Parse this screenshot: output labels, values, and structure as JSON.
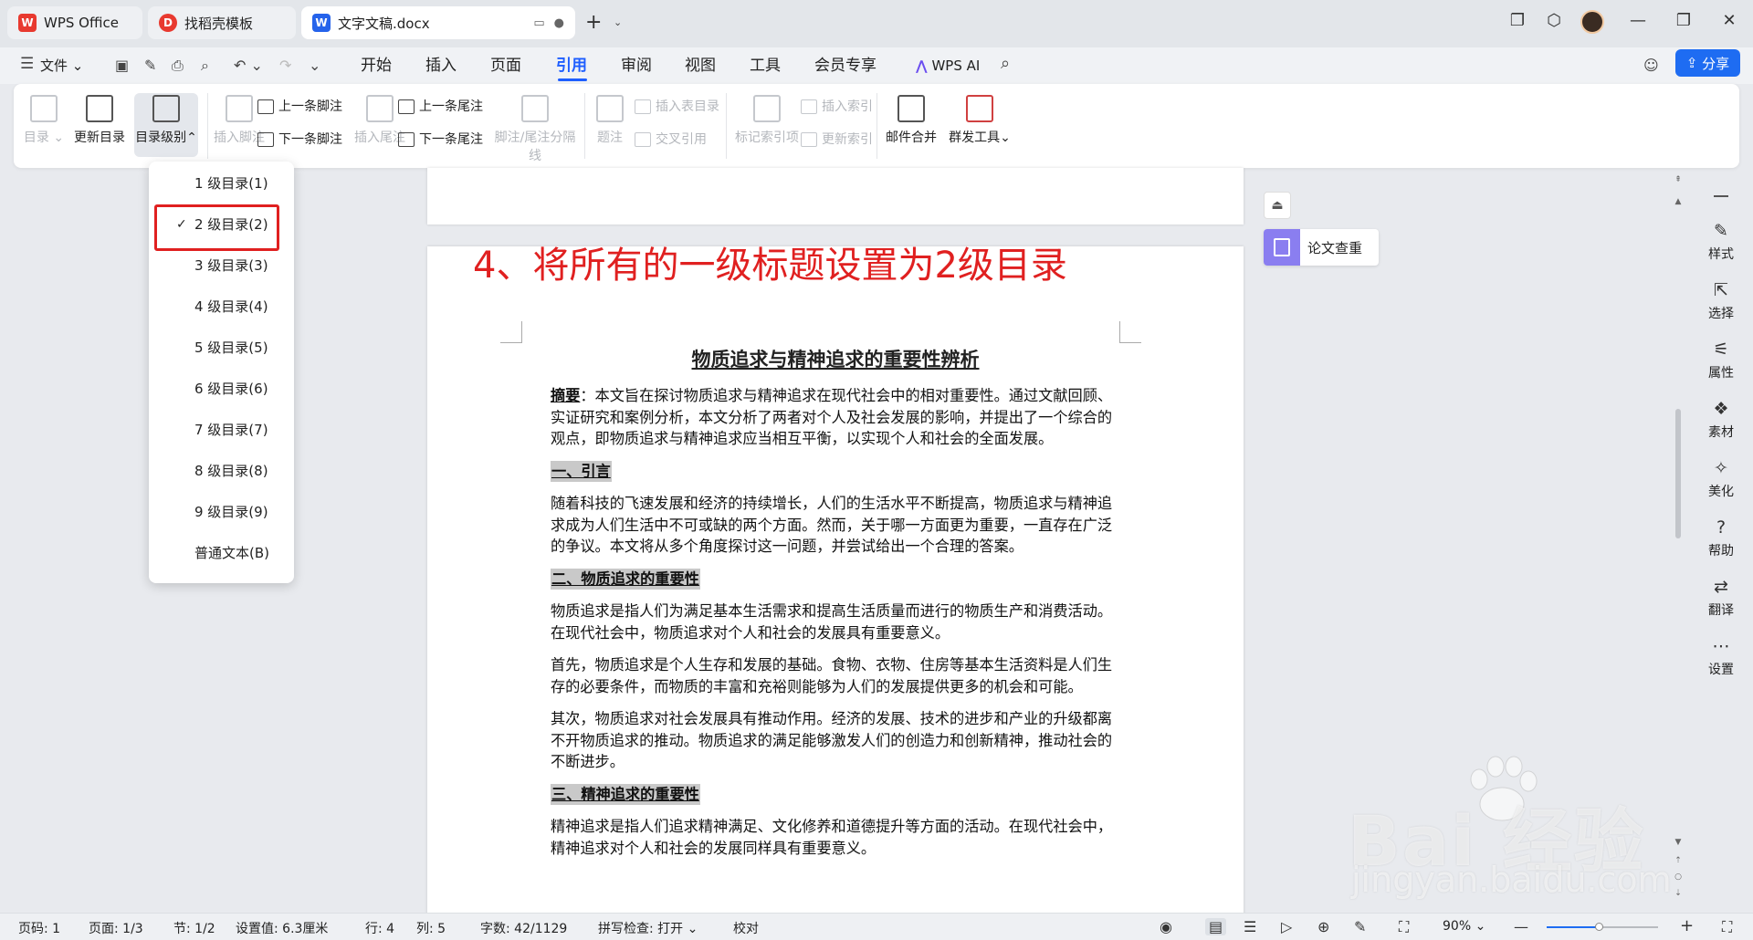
{
  "tabs": [
    {
      "label": "WPS Office",
      "logo": "W"
    },
    {
      "label": "找稻壳模板",
      "logo": "D"
    },
    {
      "label": "文字文稿.docx",
      "logo": "W"
    }
  ],
  "menu": {
    "file": "文件",
    "items": [
      "开始",
      "插入",
      "页面",
      "引用",
      "审阅",
      "视图",
      "工具",
      "会员专享"
    ],
    "active": "引用",
    "wps_ai": "WPS AI",
    "share": "分享"
  },
  "ribbon": {
    "toc": "目录",
    "update_toc": "更新目录",
    "toc_level": "目录级别",
    "insert_footnote": "插入脚注",
    "prev_footnote": "上一条脚注",
    "next_footnote": "下一条脚注",
    "insert_endnote": "插入尾注",
    "prev_endnote": "上一条尾注",
    "next_endnote": "下一条尾注",
    "separator": "脚注/尾注分隔线",
    "caption": "题注",
    "insert_table_toc": "插入表目录",
    "cross_ref": "交叉引用",
    "mark_index": "标记索引项",
    "insert_index": "插入索引",
    "update_index": "更新索引",
    "mail_merge": "邮件合并",
    "bulk_tools": "群发工具"
  },
  "dropdown": {
    "items": [
      "1 级目录(1)",
      "2 级目录(2)",
      "3 级目录(3)",
      "4 级目录(4)",
      "5 级目录(5)",
      "6 级目录(6)",
      "7 级目录(7)",
      "8 级目录(8)",
      "9 级目录(9)",
      "普通文本(B)"
    ],
    "checked_index": 1
  },
  "annotation": "4、将所有的一级标题设置为2级目录",
  "document": {
    "title": "物质追求与精神追求的重要性辨析",
    "abstract_label": "摘要",
    "abstract": "：本文旨在探讨物质追求与精神追求在现代社会中的相对重要性。通过文献回顾、实证研究和案例分析，本文分析了两者对个人及社会发展的影响，并提出了一个综合的观点，即物质追求与精神追求应当相互平衡，以实现个人和社会的全面发展。",
    "h1": "一、引言",
    "p1": "随着科技的飞速发展和经济的持续增长，人们的生活水平不断提高，物质追求与精神追求成为人们生活中不可或缺的两个方面。然而，关于哪一方面更为重要，一直存在广泛的争议。本文将从多个角度探讨这一问题，并尝试给出一个合理的答案。",
    "h2": "二、物质追求的重要性",
    "p2": "物质追求是指人们为满足基本生活需求和提高生活质量而进行的物质生产和消费活动。在现代社会中，物质追求对个人和社会的发展具有重要意义。",
    "p3": "首先，物质追求是个人生存和发展的基础。食物、衣物、住房等基本生活资料是人们生存的必要条件，而物质的丰富和充裕则能够为人们的发展提供更多的机会和可能。",
    "p4": "其次，物质追求对社会发展具有推动作用。经济的发展、技术的进步和产业的升级都离不开物质追求的推动。物质追求的满足能够激发人们的创造力和创新精神，推动社会的不断进步。",
    "h3": "三、精神追求的重要性",
    "p5": "精神追求是指人们追求精神满足、文化修养和道德提升等方面的活动。在现代社会中，精神追求对个人和社会的发展同样具有重要意义。"
  },
  "side_card": "论文查重",
  "sidebar": [
    "样式",
    "选择",
    "属性",
    "素材",
    "美化",
    "帮助",
    "翻译",
    "设置"
  ],
  "status": {
    "page_no": "页码: 1",
    "pages": "页面: 1/3",
    "section": "节: 1/2",
    "setting": "设置值: 6.3厘米",
    "row": "行: 4",
    "col": "列: 5",
    "words": "字数: 42/1129",
    "spell": "拼写检查: 打开",
    "proof": "校对",
    "zoom": "90%",
    "zoom_level": 0.47
  },
  "watermark": {
    "brand": "Bai 经验",
    "url": "jingyan.baidu.com"
  },
  "colors": {
    "accent": "#1e5eff",
    "annotation": "#e02020",
    "heading_bg": "#c9c9c9"
  }
}
